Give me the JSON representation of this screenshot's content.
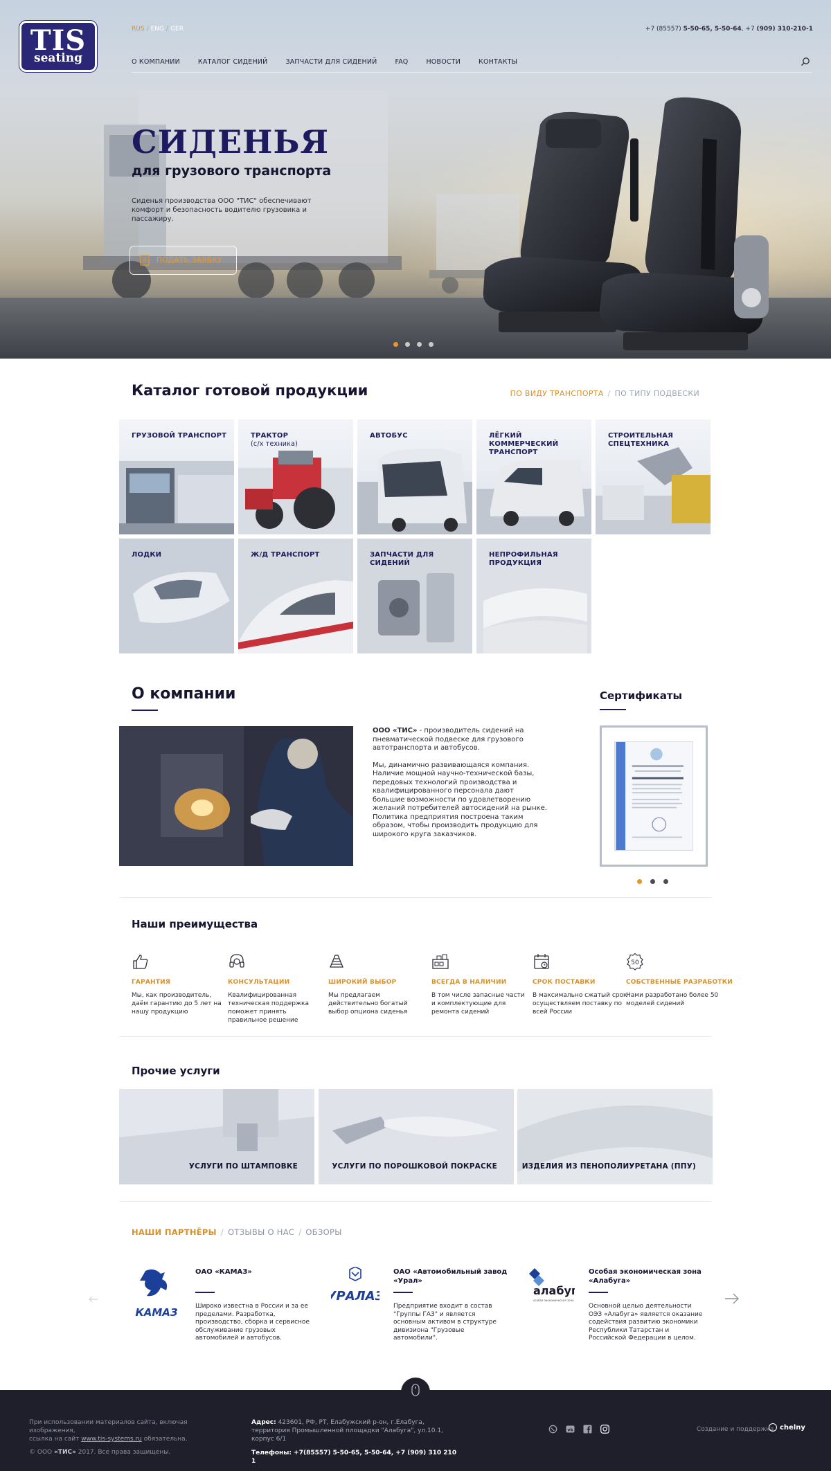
{
  "header": {
    "logo_line1": "TIS",
    "logo_line2": "seating",
    "langs": [
      "RUS",
      "ENG",
      "GER"
    ],
    "phone_prefix": "+7 (85557) ",
    "phone_main": "5-50-65, 5-50-64",
    "phone_sep": ", +7 ",
    "phone_mobile": "(909) 310-210-1",
    "nav": [
      "О КОМПАНИИ",
      "КАТАЛОГ СИДЕНИЙ",
      "ЗАПЧАСТИ ДЛЯ СИДЕНИЙ",
      "FAQ",
      "НОВОСТИ",
      "КОНТАКТЫ"
    ]
  },
  "hero": {
    "title": "СИДЕНЬЯ",
    "subtitle": "для грузового транспорта",
    "description": "Сиденья производства ООО \"ТИС\" обеспечивают комфорт и безопасность водителю грузовика и пассажиру.",
    "button": "ПОДАТЬ ЗАЯВКУ",
    "slides": 4,
    "active_slide": 1
  },
  "catalog": {
    "title": "Каталог готовой продукции",
    "tab_active": "ПО ВИДУ ТРАНСПОРТА",
    "tab_inactive": "ПО ТИПУ ПОДВЕСКИ",
    "tiles": [
      {
        "label": "ГРУЗОВОЙ ТРАНСПОРТ",
        "sub": ""
      },
      {
        "label": "ТРАКТОР",
        "sub": "(с/х техника)"
      },
      {
        "label": "АВТОБУС",
        "sub": ""
      },
      {
        "label": "ЛЁГКИЙ КОММЕРЧЕСКИЙ ТРАНСПОРТ",
        "sub": ""
      },
      {
        "label": "СТРОИТЕЛЬНАЯ СПЕЦТЕХНИКА",
        "sub": ""
      },
      {
        "label": "ЛОДКИ",
        "sub": ""
      },
      {
        "label": "Ж/Д ТРАНСПОРТ",
        "sub": ""
      },
      {
        "label": "ЗАПЧАСТИ ДЛЯ СИДЕНИЙ",
        "sub": ""
      },
      {
        "label": "НЕПРОФИЛЬНАЯ ПРОДУКЦИЯ",
        "sub": ""
      }
    ]
  },
  "about": {
    "title": "О компании",
    "p1_bold": "ООО «ТИС»",
    "p1_rest": " - производитель сидений на пневматической подвеске для грузового автотранспорта и автобусов.",
    "p2": "Мы, динамично развивающаяся компания. Наличие мощной научно-технической базы, передовых технологий производства и квалифицированного персонала дают большие возможности по удовлетворению желаний потребителей автосидений на рынке. Политика предприятия построена таким образом, чтобы производить продукцию для широкого круга заказчиков."
  },
  "certificates": {
    "title": "Сертификаты",
    "slides": 3,
    "active_slide": 1
  },
  "advantages": {
    "title": "Наши преимущества",
    "items": [
      {
        "icon": "thumbs-up-icon",
        "title": "ГАРАНТИЯ",
        "text": "Мы, как производитель, даём гарантию до 5 лет на нашу продукцию"
      },
      {
        "icon": "headset-icon",
        "title": "КОНСУЛЬТАЦИИ",
        "text": "Квалифицированная техническая поддержка поможет принять правильное решение"
      },
      {
        "icon": "layers-icon",
        "title": "ШИРОКИЙ ВЫБОР",
        "text": "Мы предлагаем действительно богатый выбор опциона сиденья"
      },
      {
        "icon": "warehouse-icon",
        "title": "ВСЕГДА В НАЛИЧИИ",
        "text": "В том числе запасные части и комплектующие для ремонта сидений"
      },
      {
        "icon": "calendar-icon",
        "title": "СРОК ПОСТАВКИ",
        "text": "В максимально сжатый срок осуществляем поставку по всей России"
      },
      {
        "icon": "badge-50-icon",
        "title": "СОБСТВЕННЫЕ РАЗРАБОТКИ",
        "text": "Нами разработано более 50 моделей сидений"
      }
    ]
  },
  "services": {
    "title": "Прочие услуги",
    "items": [
      "УСЛУГИ ПО ШТАМПОВКЕ",
      "УСЛУГИ ПО ПОРОШКОВОЙ ПОКРАСКЕ",
      "ИЗДЕЛИЯ ИЗ ПЕНОПОЛИУРЕТАНА (ППУ)"
    ]
  },
  "partners": {
    "tab_active": "НАШИ ПАРТНЁРЫ",
    "tab2": "ОТЗЫВЫ О НАС",
    "tab3": "ОБЗОРЫ",
    "items": [
      {
        "logo": "kamaz-logo",
        "logo_text": "КАМАЗ",
        "name": "ОАО «КАМАЗ»",
        "text": "Широко известна в России и за ее пределами. Разработка, производство, сборка и сервисное обслуживание грузовых автомобилей и автобусов."
      },
      {
        "logo": "ural-logo",
        "logo_text": "УРАЛАЗ",
        "name": "ОАО «Автомобильный завод «Урал»",
        "text": "Предприятие входит в состав \"Группы ГАЗ\" и является основным активом в структуре дивизиона \"Грузовые автомобили\"."
      },
      {
        "logo": "alabuga-logo",
        "logo_text": "алабуга",
        "logo_sub": "особая экономическая зона",
        "name": "Особая экономическая зона «Алабуга»",
        "text": "Основной целью деятельности ОЭЗ «Алабуга» является оказание содействия развитию экономики Республики Татарстан и Российской Федерации в целом."
      }
    ]
  },
  "footer": {
    "notice1": "При использовании материалов сайта, включая изображения,",
    "notice2_pre": "ссылка на сайт ",
    "notice2_link": "www.tis-systems.ru",
    "notice2_post": " обязательна.",
    "copyright_pre": "© ООО ",
    "copyright_name": "«ТИС»",
    "copyright_post": " 2017. Все права защищены.",
    "addr_label": "Адрес:",
    "addr1": " 423601, РФ, РТ, Елабужский р-он, г.Елабуга,",
    "addr2": "территория Промышленной площадки \"Алабуга\", ул.10.1, корпус 6/1",
    "phones_label": "Телефоны:",
    "phones": " +7(85557) 5-50-65, 5-50-64, +7 (909) 310 210 1",
    "social": [
      "whatsapp-icon",
      "vk-icon",
      "facebook-icon",
      "instagram-icon"
    ],
    "credit": "Создание и поддержка",
    "brand": "chelny"
  },
  "colors": {
    "brand": "#1d1a5e",
    "accent": "#d8912a",
    "footer": "#1f1f2c"
  }
}
